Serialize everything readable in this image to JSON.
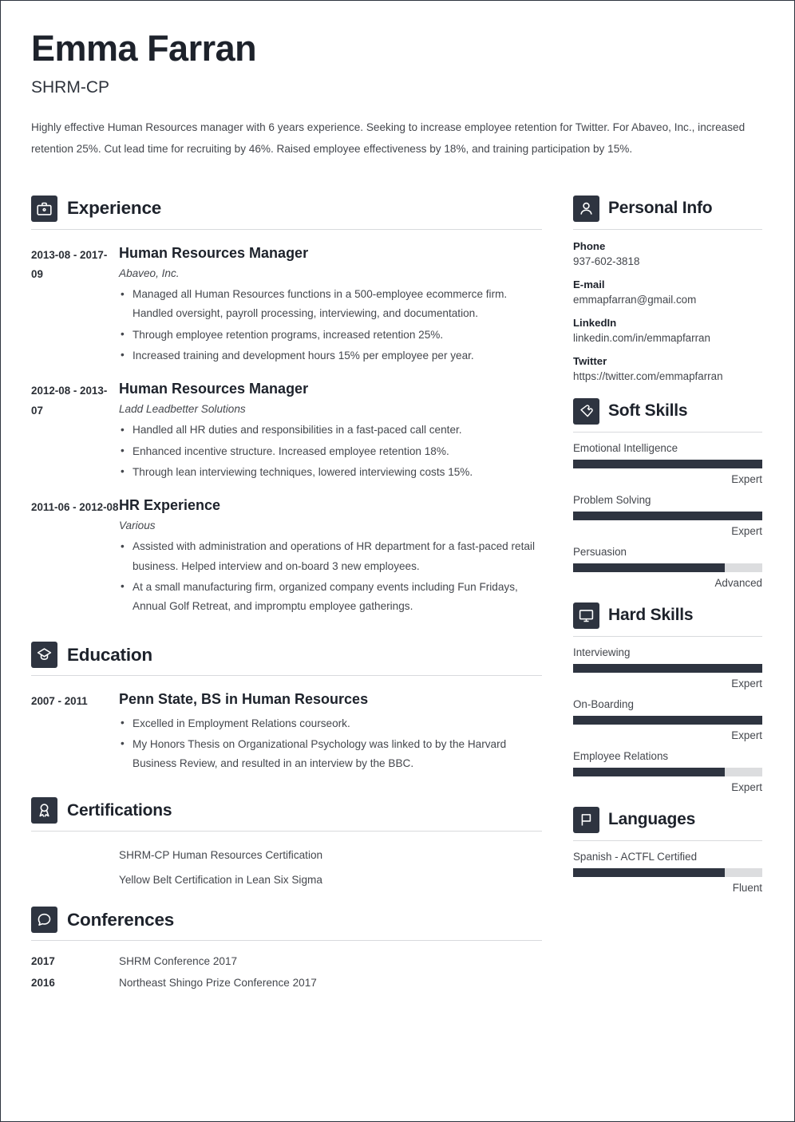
{
  "header": {
    "name": "Emma Farran",
    "title": "SHRM-CP",
    "summary": "Highly effective Human Resources manager with 6 years experience. Seeking to increase employee retention for Twitter. For Abaveo, Inc., increased retention 25%. Cut lead time for recruiting by 46%. Raised employee effectiveness by 18%, and training participation by 15%."
  },
  "theme": {
    "accent": "#2e3440",
    "text": "#44474d",
    "heading": "#1d222b",
    "rule": "#d8dadd",
    "bar_track": "#dcdddf"
  },
  "experience": {
    "heading": "Experience",
    "icon": "briefcase-icon",
    "entries": [
      {
        "dates": "2013-08 - 2017-09",
        "role": "Human Resources Manager",
        "org": "Abaveo, Inc.",
        "bullets": [
          "Managed all Human Resources functions in a 500-employee ecommerce firm. Handled oversight, payroll processing, interviewing, and documentation.",
          "Through employee retention programs, increased retention 25%.",
          "Increased training and development hours 15% per employee per year."
        ]
      },
      {
        "dates": "2012-08 - 2013-07",
        "role": "Human Resources Manager",
        "org": "Ladd Leadbetter Solutions",
        "bullets": [
          "Handled all HR duties and responsibilities in a fast-paced call center.",
          "Enhanced incentive structure. Increased employee retention 18%.",
          "Through lean interviewing techniques, lowered interviewing costs 15%."
        ]
      },
      {
        "dates": "2011-06 - 2012-08",
        "role": "HR Experience",
        "org": "Various",
        "bullets": [
          "Assisted with administration and operations of HR department for a fast-paced retail business. Helped interview and on-board 3 new employees.",
          "At a small manufacturing firm, organized company events including Fun Fridays, Annual Golf Retreat, and impromptu employee gatherings."
        ]
      }
    ]
  },
  "education": {
    "heading": "Education",
    "icon": "graduation-cap-icon",
    "entries": [
      {
        "dates": "2007 - 2011",
        "school": "Penn State, BS in Human Resources",
        "bullets": [
          "Excelled in Employment Relations courseork.",
          "My Honors Thesis on Organizational Psychology was linked to by the Harvard Business Review, and resulted in an interview by the BBC."
        ]
      }
    ]
  },
  "certifications": {
    "heading": "Certifications",
    "icon": "award-ribbon-icon",
    "items": [
      "SHRM-CP Human Resources Certification",
      "Yellow Belt Certification in Lean Six Sigma"
    ]
  },
  "conferences": {
    "heading": "Conferences",
    "icon": "speech-bubble-icon",
    "items": [
      {
        "year": "2017",
        "name": "SHRM Conference 2017"
      },
      {
        "year": "2016",
        "name": "Northeast Shingo Prize Conference 2017"
      }
    ]
  },
  "personal_info": {
    "heading": "Personal Info",
    "icon": "person-icon",
    "fields": [
      {
        "label": "Phone",
        "value": "937-602-3818"
      },
      {
        "label": "E-mail",
        "value": "emmapfarran@gmail.com"
      },
      {
        "label": "LinkedIn",
        "value": "linkedin.com/in/emmapfarran"
      },
      {
        "label": "Twitter",
        "value": "https://twitter.com/emmapfarran"
      }
    ]
  },
  "soft_skills": {
    "heading": "Soft Skills",
    "icon": "puzzle-heart-icon",
    "items": [
      {
        "name": "Emotional Intelligence",
        "level": "Expert",
        "percent": 100
      },
      {
        "name": "Problem Solving",
        "level": "Expert",
        "percent": 100
      },
      {
        "name": "Persuasion",
        "level": "Advanced",
        "percent": 80
      }
    ]
  },
  "hard_skills": {
    "heading": "Hard Skills",
    "icon": "monitor-icon",
    "items": [
      {
        "name": "Interviewing",
        "level": "Expert",
        "percent": 100
      },
      {
        "name": "On-Boarding",
        "level": "Expert",
        "percent": 100
      },
      {
        "name": "Employee Relations",
        "level": "Expert",
        "percent": 80
      }
    ]
  },
  "languages": {
    "heading": "Languages",
    "icon": "flag-icon",
    "items": [
      {
        "name": "Spanish - ACTFL Certified",
        "level": "Fluent",
        "percent": 80
      }
    ]
  }
}
